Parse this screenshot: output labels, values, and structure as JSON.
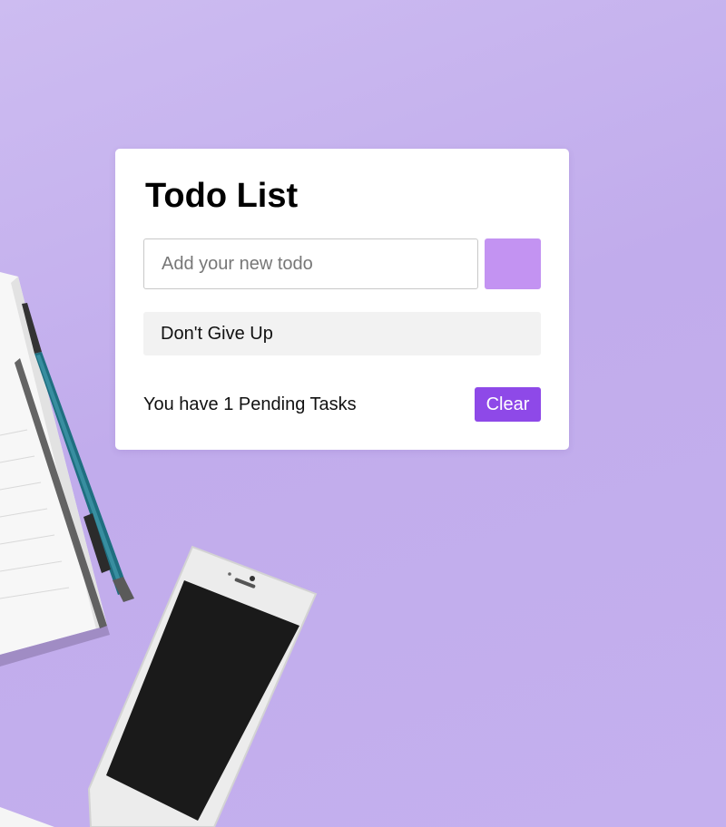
{
  "app": {
    "title": "Todo List"
  },
  "input": {
    "placeholder": "Add your new todo",
    "value": ""
  },
  "add_button": {
    "label": "",
    "color": "#c393f2"
  },
  "todos": [
    {
      "text": "Don't Give Up"
    }
  ],
  "footer": {
    "pending_text": "You have 1 Pending Tasks",
    "clear_label": "Clear",
    "clear_color": "#8e49e8"
  },
  "background": {
    "color": "#c7b4ee",
    "decorations": [
      "notebook",
      "pen",
      "smartphone"
    ]
  }
}
